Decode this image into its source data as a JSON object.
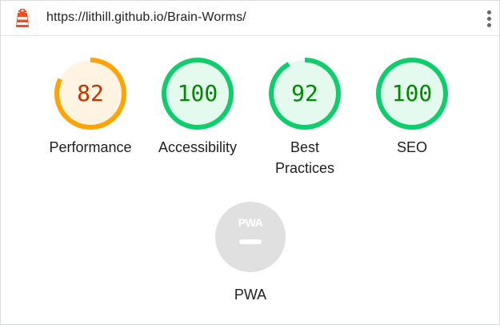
{
  "header": {
    "url": "https://lithill.github.io/Brain-Worms/",
    "logo_icon": "lighthouse-icon",
    "menu_icon": "more-vertical-icon"
  },
  "colors": {
    "pass": "#0cce6b",
    "pass_text": "#008800",
    "pass_fill": "#e5faef",
    "average": "#ffa400",
    "average_text": "#c33300",
    "average_fill": "#fff3e2",
    "track": "#e5faef",
    "pwa_bg": "#e0e0e0"
  },
  "scores": [
    {
      "label": "Performance",
      "score": 82,
      "rating": "average"
    },
    {
      "label": "Accessibility",
      "score": 100,
      "rating": "pass"
    },
    {
      "label": "Best Practices",
      "score": 92,
      "rating": "pass"
    },
    {
      "label": "SEO",
      "score": 100,
      "rating": "pass"
    }
  ],
  "pwa": {
    "label": "PWA",
    "badge_text": "PWA",
    "icon": "pwa-badge-icon"
  }
}
